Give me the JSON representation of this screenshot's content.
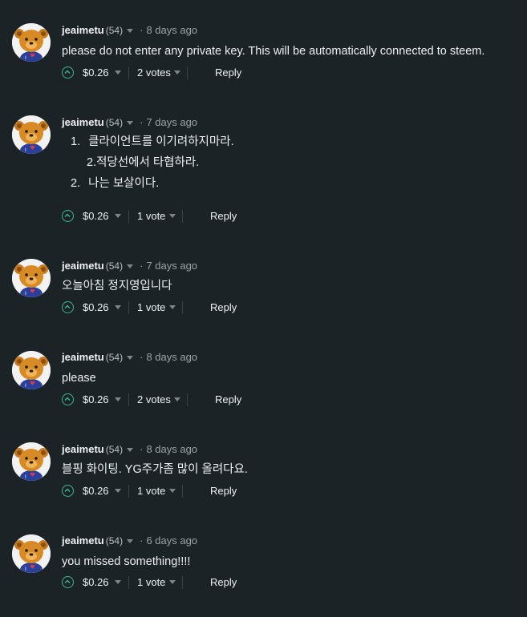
{
  "comments": [
    {
      "author": "jeaimetu",
      "reputation": "(54)",
      "age": "8 days ago",
      "body": "please do not enter any private key. This will be automatically connected to steem.",
      "payout": "$0.26",
      "votes": "2 votes",
      "reply": "Reply"
    },
    {
      "author": "jeaimetu",
      "reputation": "(54)",
      "age": "7 days ago",
      "list": [
        {
          "marker": "1.",
          "text": "클라이언트를 이기려하지마라."
        },
        {
          "marker": "",
          "text": "2.적당선에서 타협하라."
        },
        {
          "marker": "2.",
          "text": "나는 보살이다."
        }
      ],
      "payout": "$0.26",
      "votes": "1 vote",
      "reply": "Reply"
    },
    {
      "author": "jeaimetu",
      "reputation": "(54)",
      "age": "7 days ago",
      "body": "오늘아침 정지영입니다",
      "payout": "$0.26",
      "votes": "1 vote",
      "reply": "Reply"
    },
    {
      "author": "jeaimetu",
      "reputation": "(54)",
      "age": "8 days ago",
      "body": "please",
      "payout": "$0.26",
      "votes": "2 votes",
      "reply": "Reply"
    },
    {
      "author": "jeaimetu",
      "reputation": "(54)",
      "age": "8 days ago",
      "body": "블핑 화이팅. YG주가좀 많이 올려다요.",
      "payout": "$0.26",
      "votes": "1 vote",
      "reply": "Reply"
    },
    {
      "author": "jeaimetu",
      "reputation": "(54)",
      "age": "6 days ago",
      "body": "you missed something!!!!",
      "payout": "$0.26",
      "votes": "1 vote",
      "reply": "Reply"
    }
  ],
  "colors": {
    "background": "#1c2327",
    "upvote_accent": "#3ab795",
    "text": "#eef0f2",
    "muted": "#9aa3a9"
  },
  "icons": {
    "avatar": "teddy-bear-avatar",
    "upvote": "chevron-up-circle-icon",
    "dropdown": "caret-down-icon"
  }
}
